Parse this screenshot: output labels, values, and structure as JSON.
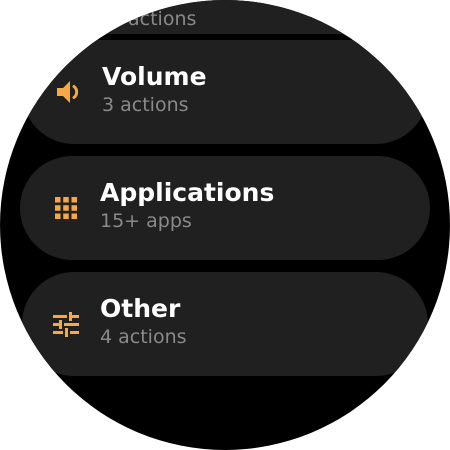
{
  "colors": {
    "background": "#000000",
    "chip": "#202020",
    "accent": "#F5A844",
    "title": "#FFFFFF",
    "subtitle": "#8A8A8A"
  },
  "items": [
    {
      "icon": "partial-hidden",
      "title": "",
      "subtitle": "actions"
    },
    {
      "icon": "volume-icon",
      "title": "Volume",
      "subtitle": "3 actions"
    },
    {
      "icon": "apps-grid-icon",
      "title": "Applications",
      "subtitle": "15+ apps"
    },
    {
      "icon": "sliders-icon",
      "title": "Other",
      "subtitle": "4 actions"
    }
  ]
}
